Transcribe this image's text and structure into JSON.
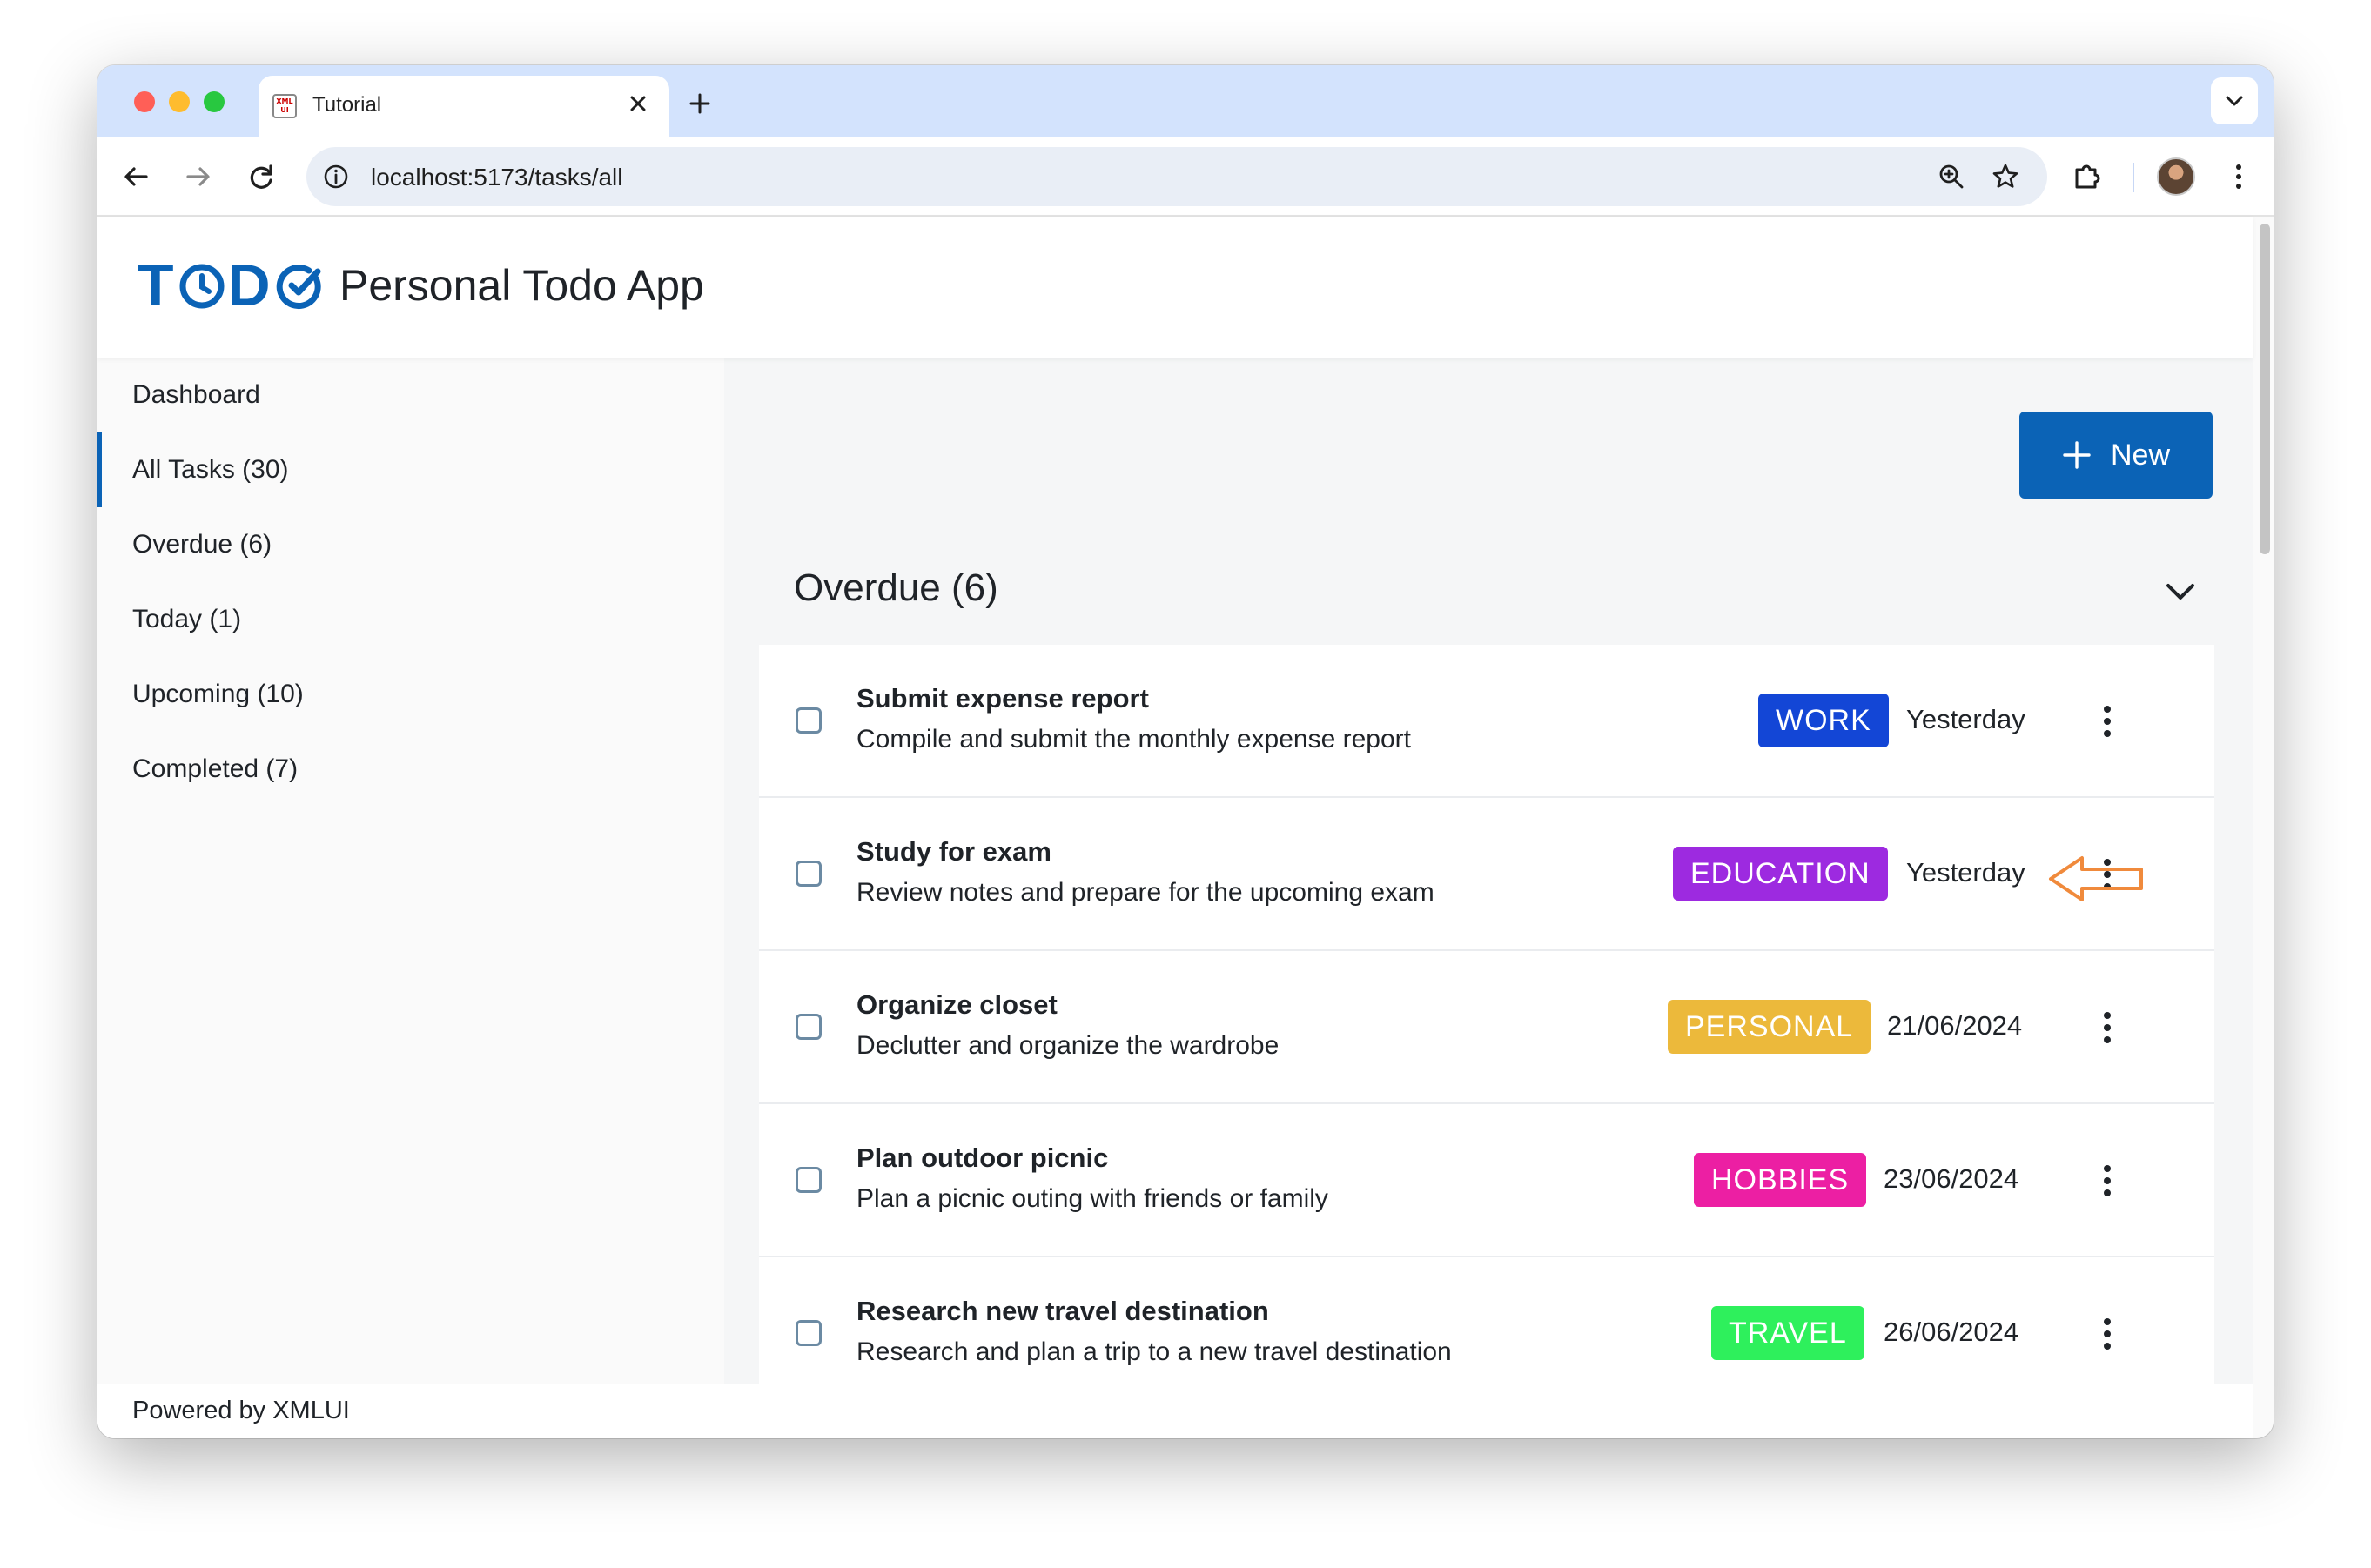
{
  "browser": {
    "tab_title": "Tutorial",
    "tab_favicon_text": "XML UI",
    "url": "localhost:5173/tasks/all"
  },
  "app": {
    "logo_text": "TODO",
    "title": "Personal Todo App",
    "brand_color": "#0b63b6",
    "footer": "Powered by XMLUI"
  },
  "sidebar": {
    "items": [
      {
        "label": "Dashboard",
        "active": false
      },
      {
        "label": "All Tasks (30)",
        "active": true
      },
      {
        "label": "Overdue (6)",
        "active": false
      },
      {
        "label": "Today (1)",
        "active": false
      },
      {
        "label": "Upcoming (10)",
        "active": false
      },
      {
        "label": "Completed (7)",
        "active": false
      }
    ]
  },
  "main": {
    "new_button_label": "New",
    "section_title": "Overdue (6)",
    "tasks": [
      {
        "title": "Submit expense report",
        "description": "Compile and submit the monthly expense report",
        "category": "WORK",
        "category_color": "#1346d6",
        "date": "Yesterday"
      },
      {
        "title": "Study for exam",
        "description": "Review notes and prepare for the upcoming exam",
        "category": "EDUCATION",
        "category_color": "#9d2ae0",
        "date": "Yesterday"
      },
      {
        "title": "Organize closet",
        "description": "Declutter and organize the wardrobe",
        "category": "PERSONAL",
        "category_color": "#ecb93b",
        "date": "21/06/2024"
      },
      {
        "title": "Plan outdoor picnic",
        "description": "Plan a picnic outing with friends or family",
        "category": "HOBBIES",
        "category_color": "#ec1fa3",
        "date": "23/06/2024"
      },
      {
        "title": "Research new travel destination",
        "description": "Research and plan a trip to a new travel destination",
        "category": "TRAVEL",
        "category_color": "#2ef05c",
        "date": "26/06/2024"
      }
    ]
  },
  "annotation": {
    "arrow_color": "#f08a3c",
    "points_to": "task menu of Study for exam"
  }
}
